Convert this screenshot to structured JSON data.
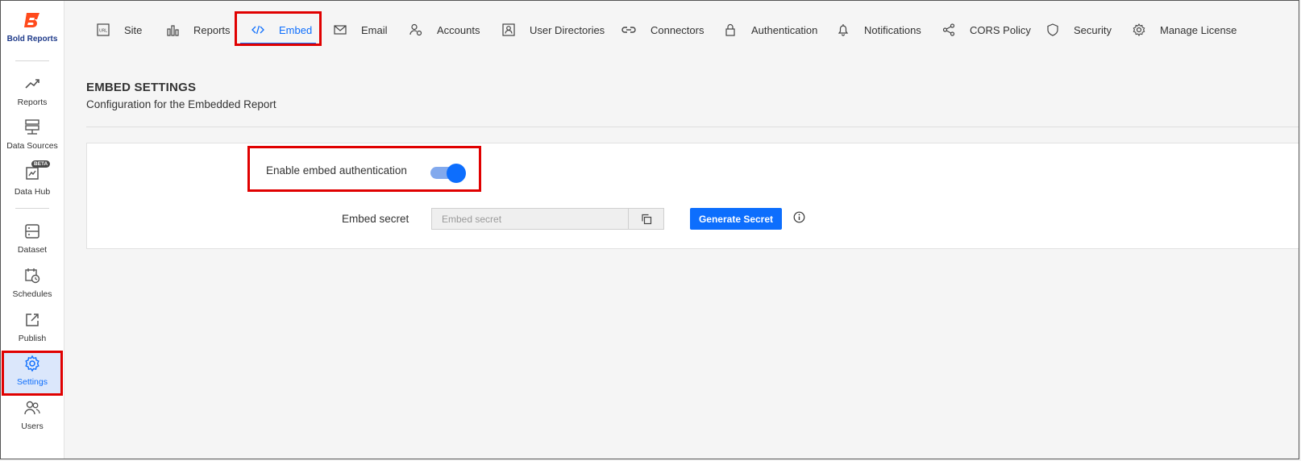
{
  "brand": {
    "name": "Bold Reports",
    "logo_color": "#ff4a1c",
    "accent": "#0d6efd",
    "highlight": "#e00000"
  },
  "sidebar": {
    "items": [
      {
        "label": "Reports",
        "icon": "trend-chart-icon"
      },
      {
        "label": "Data Sources",
        "icon": "data-sources-icon"
      },
      {
        "label": "Data Hub",
        "icon": "data-hub-icon",
        "badge": "BETA"
      },
      {
        "label": "Dataset",
        "icon": "dataset-icon"
      },
      {
        "label": "Schedules",
        "icon": "calendar-clock-icon"
      },
      {
        "label": "Publish",
        "icon": "publish-icon"
      },
      {
        "label": "Settings",
        "icon": "gear-icon",
        "active": true
      },
      {
        "label": "Users",
        "icon": "users-icon"
      }
    ]
  },
  "topnav": {
    "tabs": [
      {
        "label": "Site",
        "icon": "url-icon"
      },
      {
        "label": "Reports",
        "icon": "bar-chart-icon"
      },
      {
        "label": "Embed",
        "icon": "code-icon",
        "active": true
      },
      {
        "label": "Email",
        "icon": "envelope-icon"
      },
      {
        "label": "Accounts",
        "icon": "user-gear-icon"
      },
      {
        "label": "User Directories",
        "icon": "contact-card-icon"
      },
      {
        "label": "Connectors",
        "icon": "link-icon"
      },
      {
        "label": "Authentication",
        "icon": "lock-icon"
      },
      {
        "label": "Notifications",
        "icon": "bell-icon"
      },
      {
        "label": "CORS Policy",
        "icon": "share-nodes-icon"
      },
      {
        "label": "Security",
        "icon": "shield-icon"
      },
      {
        "label": "Manage License",
        "icon": "license-gear-icon"
      }
    ]
  },
  "page": {
    "title": "EMBED SETTINGS",
    "subtitle": "Configuration for the Embedded Report"
  },
  "embed": {
    "toggle_label": "Enable embed authentication",
    "toggle_on": true,
    "secret_label": "Embed secret",
    "secret_value": "",
    "secret_placeholder": "Embed secret",
    "generate_label": "Generate Secret"
  }
}
